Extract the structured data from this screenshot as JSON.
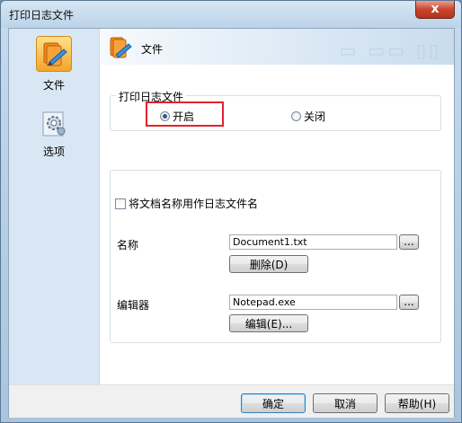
{
  "window": {
    "title": "打印日志文件",
    "close_symbol": "x"
  },
  "sidebar": {
    "items": [
      {
        "label": "文件",
        "icon": "file-edit-icon",
        "selected": true
      },
      {
        "label": "选项",
        "icon": "options-gear-icon",
        "selected": false
      }
    ]
  },
  "banner": {
    "title": "文件",
    "icon": "file-edit-icon"
  },
  "log_group": {
    "title": "打印日志文件",
    "options": [
      {
        "label": "开启",
        "selected": true
      },
      {
        "label": "关闭",
        "selected": false
      }
    ]
  },
  "settings": {
    "use_doc_name_label": "将文档名称用作日志文件名",
    "use_doc_name_checked": false,
    "name_label": "名称",
    "name_value": "Document1.txt",
    "browse_label": "...",
    "delete_label": "删除(D)",
    "editor_label": "编辑器",
    "editor_value": "Notepad.exe",
    "edit_label": "编辑(E)..."
  },
  "footer": {
    "ok": "确定",
    "cancel": "取消",
    "help": "帮助(H)"
  },
  "colors": {
    "highlight_box": "#e2222d",
    "accent": "#3c7fb1"
  }
}
